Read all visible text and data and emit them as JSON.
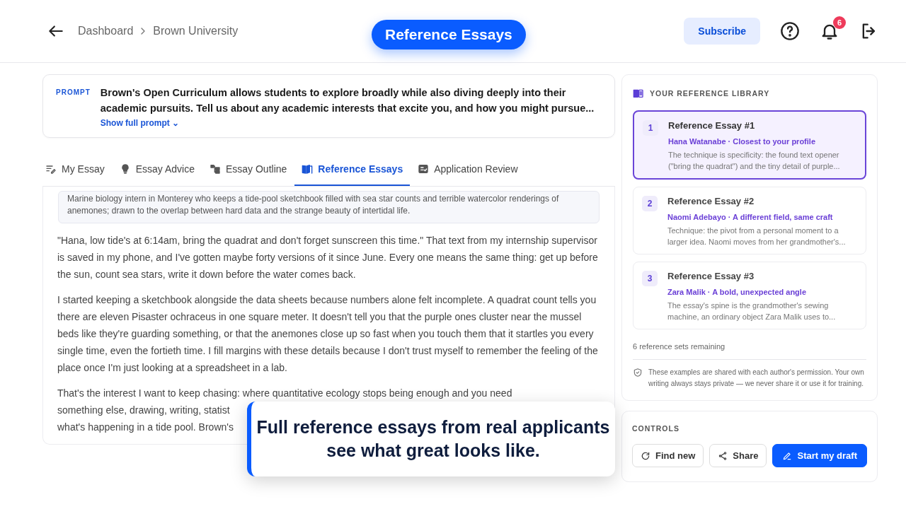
{
  "header": {
    "breadcrumbs": [
      "Dashboard",
      "Brown University"
    ],
    "title": "Reference Essays",
    "subscribe": "Subscribe",
    "notification_count": "6"
  },
  "prompt": {
    "label": "PROMPT",
    "text": "Brown's Open Curriculum allows students to explore broadly while also diving deeply into their academic pursuits. Tell us about any academic interests that excite you, and how you might pursue...",
    "link": "Show full prompt",
    "link_icon": "⌄"
  },
  "tabs": [
    {
      "label": "My Essay",
      "kind": "edit",
      "selected": false
    },
    {
      "label": "Essay Advice",
      "kind": "bulb",
      "selected": false
    },
    {
      "label": "Essay Outline",
      "kind": "outline",
      "selected": false
    },
    {
      "label": "Reference Essays",
      "kind": "book",
      "selected": true
    },
    {
      "label": "Application Review",
      "kind": "review",
      "selected": false
    }
  ],
  "essay": {
    "summary": "Marine biology intern in Monterey who keeps a tide-pool sketchbook filled with sea star counts and terrible watercolor renderings of anemones; drawn to the overlap between hard data and the strange beauty of intertidal life.",
    "paragraphs": [
      [
        "\"Hana, low tide's at 6:14am, bring the quadrat and don't forget sunscreen this time.\" That text from my internship supervisor is saved in my phone, and I've gotten maybe forty versions of it since June. Every one means the same thing: get up before the sun, count sea stars, write it down before the water comes back."
      ],
      [
        "I started keeping a sketchbook alongside the data sheets because numbers alone felt incomplete. A quadrat count tells you there are eleven Pisaster ochraceus in one square meter. It doesn't tell you that the purple ones cluster near the mussel beds like they're guarding something, or that the anemones close up so fast when you touch them that it startles you every single time, even the fortieth time. I fill margins with these details because I don't trust myself to remember the feeling of the place once I'm just looking at a spreadsheet in a lab."
      ],
      [
        "That's the interest I want to keep chasing: where quantitative ecology stops being enough and you need",
        "something else, drawing, writing, statist",
        "what's happening in a tide pool. Brown's"
      ]
    ]
  },
  "library": {
    "title": "YOUR REFERENCE LIBRARY",
    "items": [
      {
        "number": "1",
        "title": "Reference Essay #1",
        "subtitle": "Hana Watanabe · Closest to your profile",
        "description": "The technique is specificity: the found text opener (\"bring the quadrat\") and the tiny detail of purple...",
        "selected": true
      },
      {
        "number": "2",
        "title": "Reference Essay #2",
        "subtitle": "Naomi Adebayo · A different field, same craft",
        "description": "Technique: the pivot from a personal moment to a larger idea. Naomi moves from her grandmother's...",
        "selected": false
      },
      {
        "number": "3",
        "title": "Reference Essay #3",
        "subtitle": "Zara Malik · A bold, unexpected angle",
        "description": "The essay's spine is the grandmother's sewing machine, an ordinary object Zara Malik uses to...",
        "selected": false
      }
    ],
    "remaining": "6 reference sets remaining",
    "disclaimer": "These examples are shared with each author's permission. Your own writing always stays private — we never share it or use it for training."
  },
  "controls": {
    "title": "CONTROLS",
    "buttons": [
      {
        "label": "Find new",
        "kind": "refresh"
      },
      {
        "label": "Share",
        "kind": "share"
      },
      {
        "label": "Start my draft",
        "kind": "primary"
      }
    ]
  },
  "caption": {
    "lines": [
      "Full reference essays from real applicants",
      "see what great looks like."
    ]
  }
}
